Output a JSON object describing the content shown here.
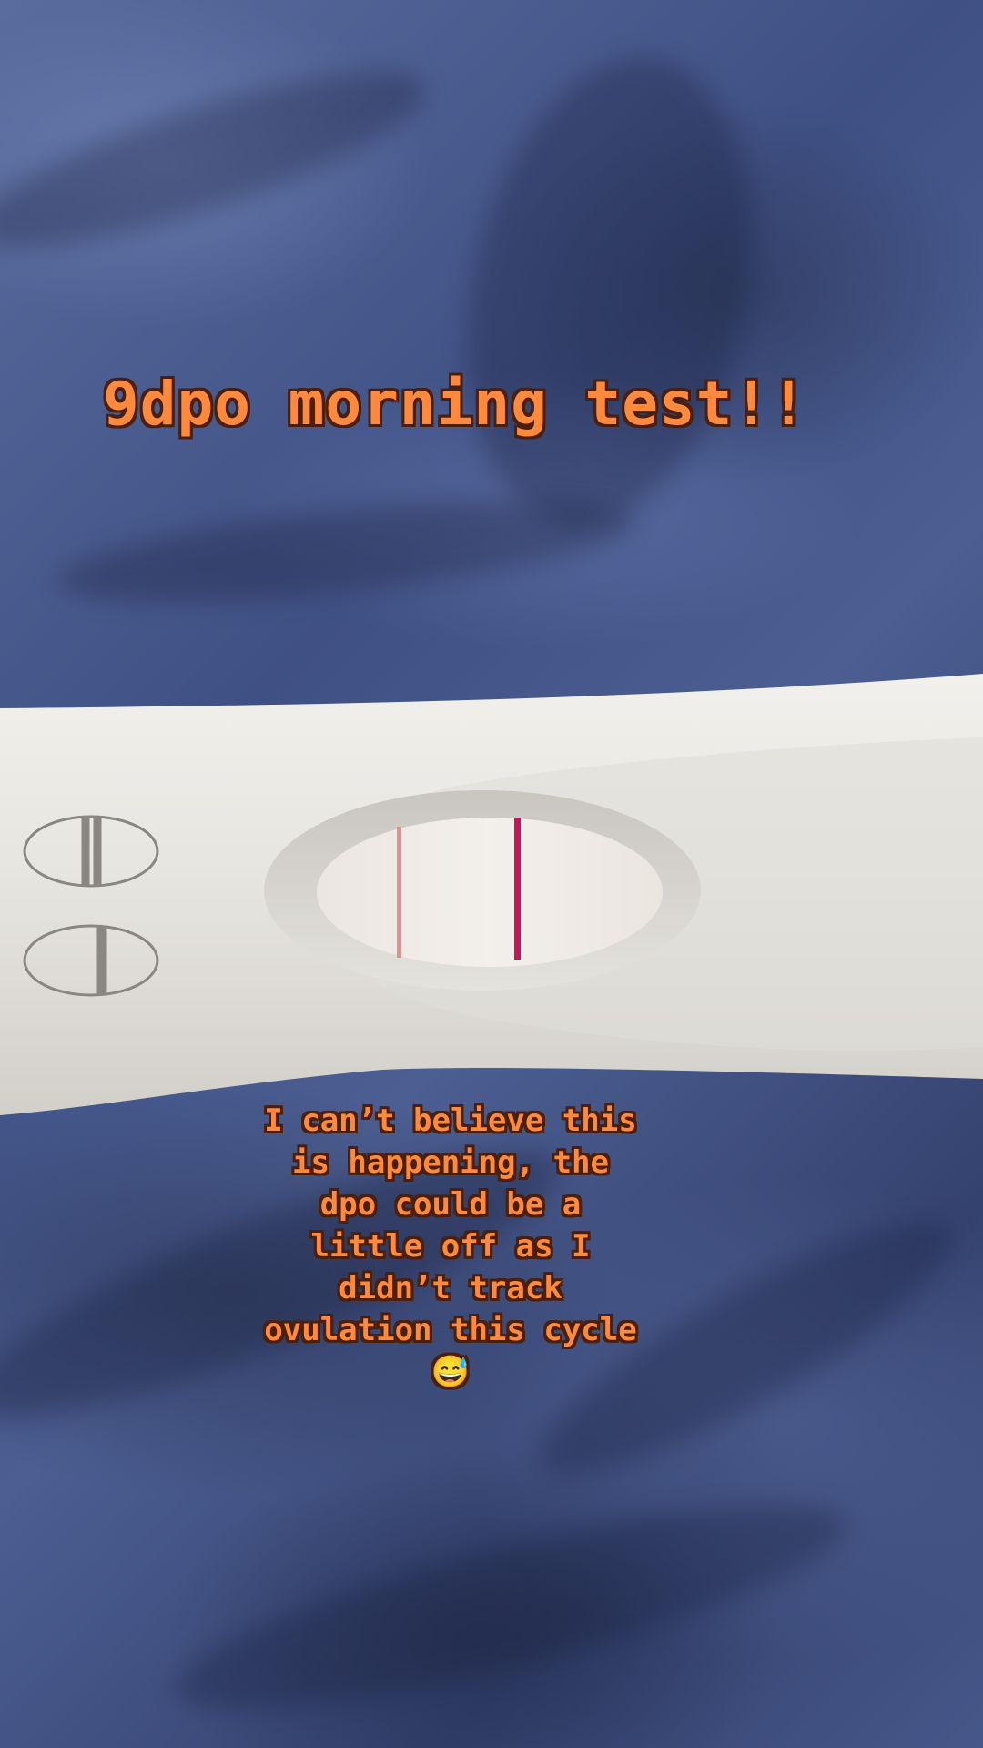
{
  "overlay": {
    "title": "9dpo morning test!!",
    "body": "I can’t believe this\nis happening, the\ndpo could be a\nlittle off as I\ndidn’t track\novulation this cycle\n😅"
  },
  "colors": {
    "caption_fill": "#ff8a3d",
    "caption_outline": "#4a1f0c",
    "background_fabric": "#3e4f7e",
    "test_body": "#ebe9e4",
    "result_line": "#c8145a"
  },
  "image": {
    "subject": "pregnancy-test-stick"
  }
}
